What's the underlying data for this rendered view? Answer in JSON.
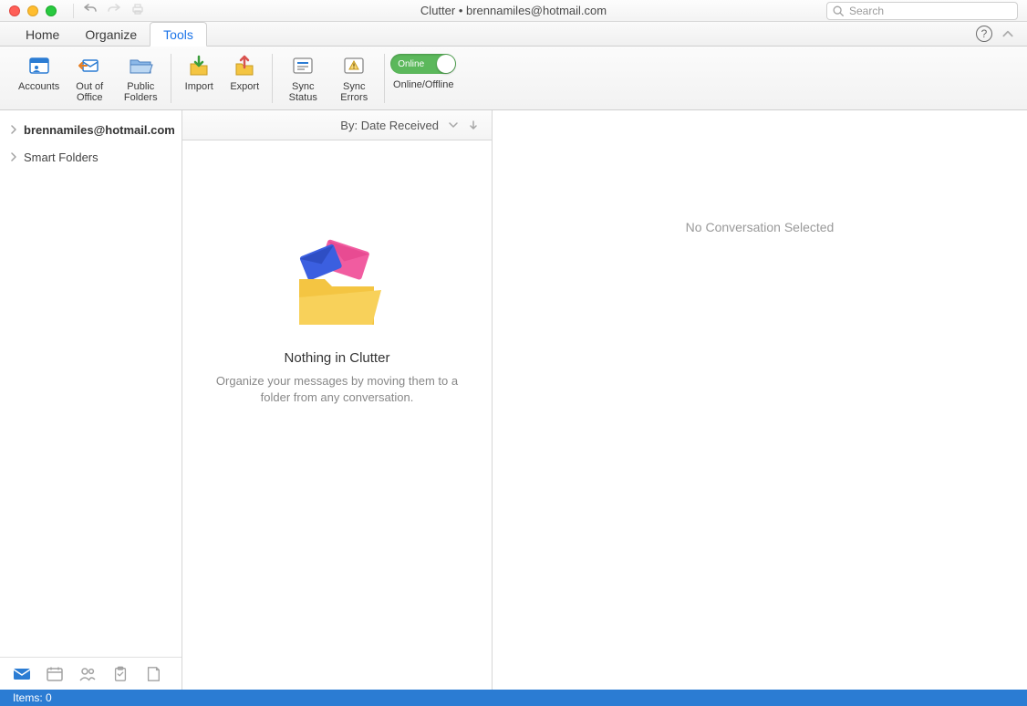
{
  "title": "Clutter • brennamiles@hotmail.com",
  "search": {
    "placeholder": "Search"
  },
  "tabs": [
    {
      "label": "Home"
    },
    {
      "label": "Organize"
    },
    {
      "label": "Tools",
      "active": true
    }
  ],
  "ribbon": {
    "accounts": "Accounts",
    "out_of_office": "Out of Office",
    "public_folders": "Public Folders",
    "import": "Import",
    "export": "Export",
    "sync_status": "Sync Status",
    "sync_errors": "Sync Errors",
    "online_label": "Online",
    "online_caption": "Online/Offline"
  },
  "sidebar": {
    "items": [
      {
        "label": "brennamiles@hotmail.com",
        "bold": true
      },
      {
        "label": "Smart Folders",
        "bold": false
      }
    ]
  },
  "msglist": {
    "sort_prefix": "By:",
    "sort_value": "Date Received",
    "empty_title": "Nothing in Clutter",
    "empty_body": "Organize your messages by moving them to a folder from any conversation."
  },
  "readpane": {
    "no_selection": "No Conversation Selected"
  },
  "statusbar": {
    "items_text": "Items: 0"
  }
}
